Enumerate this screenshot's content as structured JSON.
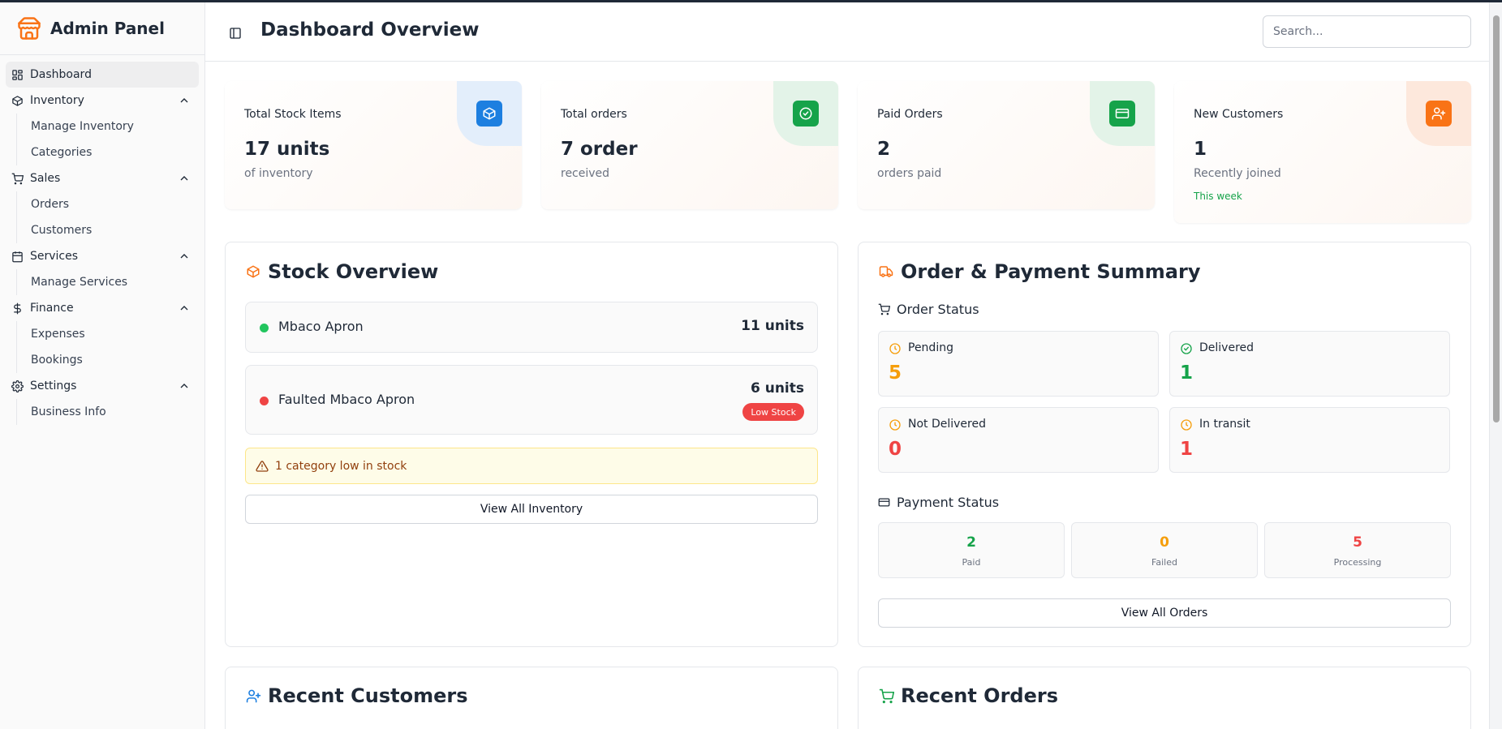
{
  "brand": {
    "title": "Admin Panel"
  },
  "sidebar": {
    "items": [
      {
        "label": "Dashboard"
      },
      {
        "label": "Inventory",
        "children": [
          "Manage Inventory",
          "Categories"
        ]
      },
      {
        "label": "Sales",
        "children": [
          "Orders",
          "Customers"
        ]
      },
      {
        "label": "Services",
        "children": [
          "Manage Services"
        ]
      },
      {
        "label": "Finance",
        "children": [
          "Expenses",
          "Bookings"
        ]
      },
      {
        "label": "Settings",
        "children": [
          "Business Info"
        ]
      }
    ]
  },
  "header": {
    "title": "Dashboard Overview",
    "search_placeholder": "Search..."
  },
  "stats": [
    {
      "label": "Total Stock Items",
      "value": "17 units",
      "sub": "of inventory",
      "icon": "cube-icon",
      "color": "#1d7fe0",
      "bg": "#e3eefb"
    },
    {
      "label": "Total orders",
      "value": "7 order",
      "sub": "received",
      "icon": "check-circle-icon",
      "color": "#16a34a",
      "bg": "#e3f3e8"
    },
    {
      "label": "Paid Orders",
      "value": "2",
      "sub": "orders paid",
      "icon": "credit-card-icon",
      "color": "#16a34a",
      "bg": "#e3f3e8"
    },
    {
      "label": "New Customers",
      "value": "1",
      "sub": "Recently joined",
      "extra": "This week",
      "icon": "user-plus-icon",
      "color": "#f97316",
      "bg": "#fde8dc"
    }
  ],
  "stock": {
    "title": "Stock Overview",
    "items": [
      {
        "name": "Mbaco Apron",
        "units": "11 units",
        "status_color": "#22c55e"
      },
      {
        "name": "Faulted Mbaco Apron",
        "units": "6 units",
        "status_color": "#ef4444",
        "badge": "Low Stock"
      }
    ],
    "alert": "1 category low in stock",
    "button": "View All Inventory"
  },
  "orders": {
    "title": "Order & Payment Summary",
    "order_status_title": "Order Status",
    "order_status": [
      {
        "label": "Pending",
        "value": "5",
        "color": "#f59e0b",
        "icon": "clock-icon"
      },
      {
        "label": "Delivered",
        "value": "1",
        "color": "#16a34a",
        "icon": "check-circle-icon"
      },
      {
        "label": "Not Delivered",
        "value": "0",
        "color": "#ef4444",
        "icon": "clock-icon"
      },
      {
        "label": "In transit",
        "value": "1",
        "color": "#ef4444",
        "icon": "clock-icon"
      }
    ],
    "payment_status_title": "Payment Status",
    "payment_status": [
      {
        "label": "Paid",
        "value": "2",
        "color": "#16a34a"
      },
      {
        "label": "Failed",
        "value": "0",
        "color": "#f59e0b"
      },
      {
        "label": "Processing",
        "value": "5",
        "color": "#ef4444"
      }
    ],
    "button": "View All Orders"
  },
  "recent_customers": {
    "title": "Recent Customers"
  },
  "recent_orders": {
    "title": "Recent Orders"
  },
  "colors": {
    "accent": "#f97316",
    "border": "#e5e7eb"
  }
}
